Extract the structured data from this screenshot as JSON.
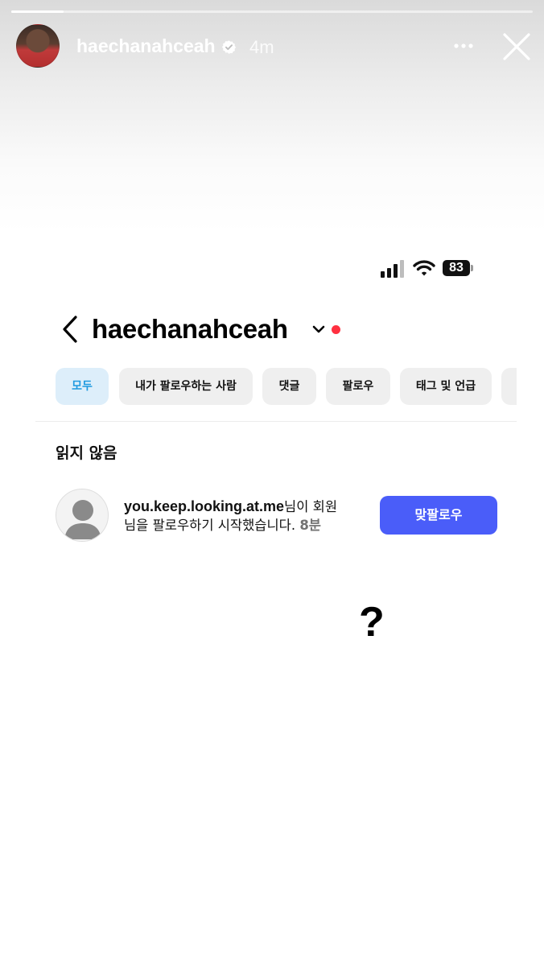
{
  "story": {
    "username": "haechanahceah",
    "time": "4m",
    "progress": 0.1,
    "avatar_icon": "profile-photo",
    "more_icon": "more-horizontal-icon",
    "close_icon": "close-icon",
    "verified_icon": "verified-badge-icon"
  },
  "screenshot": {
    "status_bar": {
      "battery": "83"
    },
    "header": {
      "account_name": "haechanahceah",
      "back_icon": "chevron-left-icon",
      "dropdown_icon": "chevron-down-icon",
      "dot_color": "#ff3040"
    },
    "filters": [
      {
        "label": "모두",
        "active": true
      },
      {
        "label": "내가 팔로우하는 사람",
        "active": false
      },
      {
        "label": "댓글",
        "active": false
      },
      {
        "label": "팔로우",
        "active": false
      },
      {
        "label": "태그 및 언급",
        "active": false
      }
    ],
    "section_title": "읽지 않음",
    "notification": {
      "username": "you.keep.looking.at.me",
      "message_part1": "님이 회원",
      "message_part2": "님을 팔로우하기 시작했습니다.",
      "time_ago": "8분",
      "button_label": "맞팔로우",
      "button_color": "#4a5df9"
    }
  },
  "annotation": "?"
}
